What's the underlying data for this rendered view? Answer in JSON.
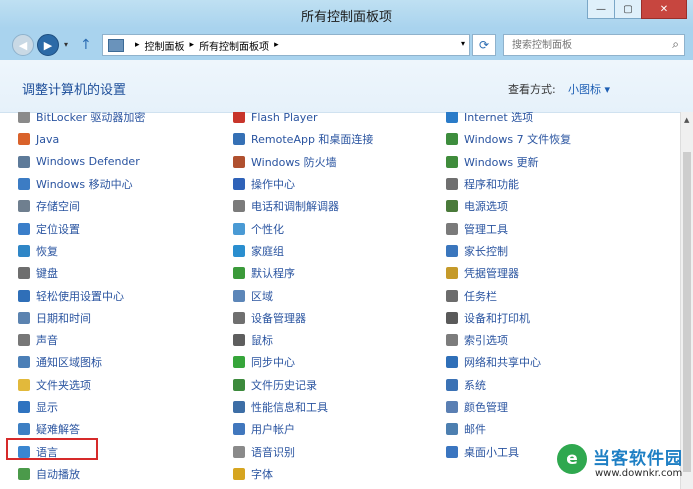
{
  "window": {
    "title": "所有控制面板项",
    "buttons": [
      {
        "name": "minimize-button",
        "glyph": "—"
      },
      {
        "name": "maximize-button",
        "glyph": "▢"
      },
      {
        "name": "close-button",
        "glyph": "✕"
      }
    ]
  },
  "nav": {
    "back_glyph": "◀",
    "forward_glyph": "▶",
    "recent_glyph": "▾",
    "up_glyph": "↑",
    "breadcrumb": [
      "控制面板",
      "所有控制面板项"
    ],
    "sep_glyph": "▸",
    "addr_dropdown_glyph": "▾",
    "refresh_glyph": "⟳",
    "search_placeholder": "搜索控制面板",
    "search_glyph": "⌕"
  },
  "header": {
    "title": "调整计算机的设置",
    "view_label": "查看方式:",
    "view_value": "小图标 ▾"
  },
  "columns": [
    [
      {
        "label": "BitLocker 驱动器加密",
        "color": "#8a8a8a"
      },
      {
        "label": "Java",
        "color": "#d9622b"
      },
      {
        "label": "Windows Defender",
        "color": "#5d7a99"
      },
      {
        "label": "Windows 移动中心",
        "color": "#3c7cc4"
      },
      {
        "label": "存储空间",
        "color": "#6f7f8f"
      },
      {
        "label": "定位设置",
        "color": "#3a7ec9"
      },
      {
        "label": "恢复",
        "color": "#2f86c6"
      },
      {
        "label": "键盘",
        "color": "#6e6e6e"
      },
      {
        "label": "轻松使用设置中心",
        "color": "#2f6fb8"
      },
      {
        "label": "日期和时间",
        "color": "#5b83b0"
      },
      {
        "label": "声音",
        "color": "#777777"
      },
      {
        "label": "通知区域图标",
        "color": "#4b7fb7"
      },
      {
        "label": "文件夹选项",
        "color": "#e2b93b"
      },
      {
        "label": "显示",
        "color": "#2f73c0"
      },
      {
        "label": "疑难解答",
        "color": "#3d7fc3"
      },
      {
        "label": "语言",
        "color": "#3a86d0"
      },
      {
        "label": "自动播放",
        "color": "#4b9a4a"
      }
    ],
    [
      {
        "label": "Flash Player",
        "color": "#c8352b"
      },
      {
        "label": "RemoteApp 和桌面连接",
        "color": "#3570b5"
      },
      {
        "label": "Windows 防火墙",
        "color": "#b0502f"
      },
      {
        "label": "操作中心",
        "color": "#2f62b8"
      },
      {
        "label": "电话和调制解调器",
        "color": "#7b7b7b"
      },
      {
        "label": "个性化",
        "color": "#4a9ad4"
      },
      {
        "label": "家庭组",
        "color": "#2a8ecf"
      },
      {
        "label": "默认程序",
        "color": "#3b9a3a"
      },
      {
        "label": "区域",
        "color": "#5c86b8"
      },
      {
        "label": "设备管理器",
        "color": "#6f6f6f"
      },
      {
        "label": "鼠标",
        "color": "#5e5e5e"
      },
      {
        "label": "同步中心",
        "color": "#36a53a"
      },
      {
        "label": "文件历史记录",
        "color": "#3c8a3c"
      },
      {
        "label": "性能信息和工具",
        "color": "#3d6ea6"
      },
      {
        "label": "用户帐户",
        "color": "#4177bd"
      },
      {
        "label": "语音识别",
        "color": "#8a8a8a"
      },
      {
        "label": "字体",
        "color": "#d6a520"
      }
    ],
    [
      {
        "label": "Internet 选项",
        "color": "#2a7bc8"
      },
      {
        "label": "Windows 7 文件恢复",
        "color": "#3d8d3d"
      },
      {
        "label": "Windows 更新",
        "color": "#3f8c3b"
      },
      {
        "label": "程序和功能",
        "color": "#6f6f6f"
      },
      {
        "label": "电源选项",
        "color": "#4a7a3a"
      },
      {
        "label": "管理工具",
        "color": "#7a7a7a"
      },
      {
        "label": "家长控制",
        "color": "#3a76bd"
      },
      {
        "label": "凭据管理器",
        "color": "#c59a2a"
      },
      {
        "label": "任务栏",
        "color": "#6c6c6c"
      },
      {
        "label": "设备和打印机",
        "color": "#5a5a5a"
      },
      {
        "label": "索引选项",
        "color": "#7c7c7c"
      },
      {
        "label": "网络和共享中心",
        "color": "#2f6fb8"
      },
      {
        "label": "系统",
        "color": "#3b72b5"
      },
      {
        "label": "颜色管理",
        "color": "#5a7fb3"
      },
      {
        "label": "邮件",
        "color": "#4d7fb0"
      },
      {
        "label": "桌面小工具",
        "color": "#3a75c0"
      }
    ]
  ],
  "watermark": {
    "logo_glyph": "e",
    "name": "当客软件园",
    "url": "www.downkr.com"
  },
  "scroll_glyph": "▲"
}
